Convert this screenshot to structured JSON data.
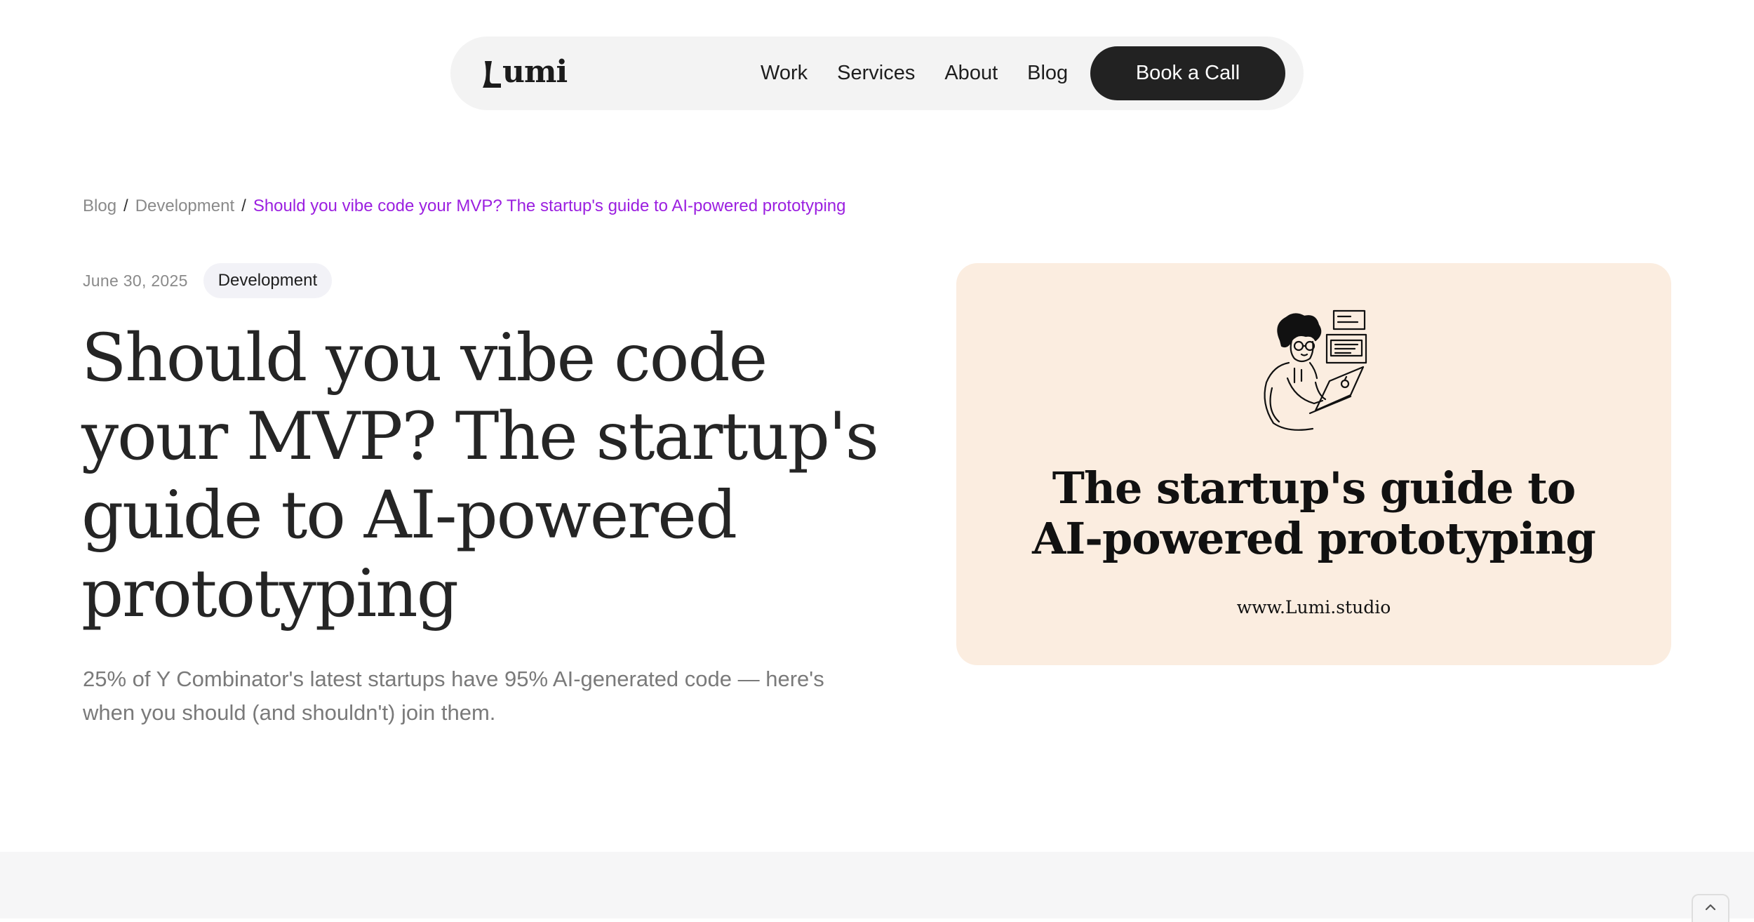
{
  "nav": {
    "logo_text": "umi",
    "links": [
      {
        "label": "Work"
      },
      {
        "label": "Services"
      },
      {
        "label": "About"
      },
      {
        "label": "Blog"
      }
    ],
    "cta_label": "Book a Call"
  },
  "breadcrumb": {
    "items": [
      "Blog",
      "Development"
    ],
    "separator": "/",
    "current": "Should you vibe code your MVP? The startup's guide to AI-powered prototyping"
  },
  "article": {
    "date": "June 30, 2025",
    "category": "Development",
    "title": "Should you vibe code your MVP? The startup's guide to AI-powered prototyping",
    "subtitle": "25% of Y Combinator's latest startups have 95% AI-generated code — here's when you should (and shouldn't) join them."
  },
  "hero": {
    "title_line1": "The startup's guide to",
    "title_line2": "AI-powered prototyping",
    "url": "www.Lumi.studio",
    "background": "#fbede0"
  },
  "colors": {
    "accent": "#9b1fe0",
    "cta_bg": "#222222",
    "nav_bg": "#f3f3f3",
    "muted_text": "#8a8a8a"
  },
  "icons": {
    "logo": "lumi-logo-mark",
    "hero": "person-on-laptop-illustration",
    "scroll": "chevron-up-icon"
  }
}
